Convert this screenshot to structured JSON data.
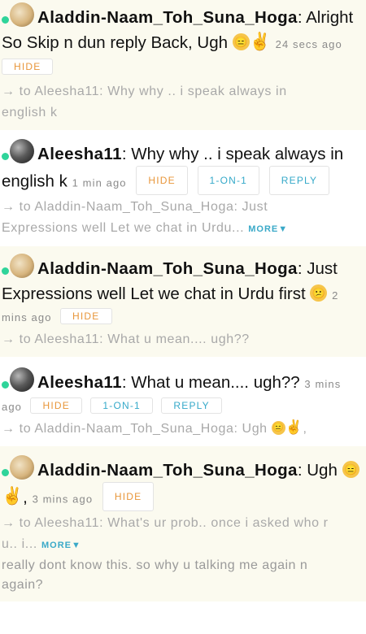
{
  "messages": [
    {
      "user": "Aladdin-Naam_Toh_Suna_Hoga",
      "text_line1": ": Alright",
      "text_line2": "So Skip n dun reply Back, Ugh",
      "time": "24 secs ago",
      "hide": "HIDE",
      "reply_to_line1": "→ to Aleesha11: Why why .. i speak always in",
      "reply_to_line2": "english k"
    },
    {
      "user": "Aleesha11",
      "text_line1": ": Why why .. i speak always in",
      "text_line2": "english k",
      "time": "1 min ago",
      "hide": "HIDE",
      "one_on_one": "1-ON-1",
      "reply": "REPLY",
      "reply_to_line1": "→ to Aladdin-Naam_Toh_Suna_Hoga: Just",
      "reply_to_line2": "Expressions well Let we chat in Urdu...",
      "more": "MORE▼"
    },
    {
      "user": "Aladdin-Naam_Toh_Suna_Hoga",
      "text_line1": ": Just",
      "text_line2": "Expressions well Let we chat in Urdu first",
      "time_a": "2",
      "time_b": "mins ago",
      "hide": "HIDE",
      "reply_to_line1": "→ to Aleesha11: What u mean.... ugh??"
    },
    {
      "user": "Aleesha11",
      "text_line1": ": What u mean.... ugh??",
      "time_a": "3 mins",
      "time_b": "ago",
      "hide": "HIDE",
      "one_on_one": "1-ON-1",
      "reply": "REPLY",
      "reply_to_line1": "→ to Aladdin-Naam_Toh_Suna_Hoga: Ugh",
      "reply_to_tail": ","
    },
    {
      "user": "Aladdin-Naam_Toh_Suna_Hoga",
      "text_line1": ": Ugh",
      "text_line2_suffix": ",",
      "time": "3 mins ago",
      "hide": "HIDE",
      "reply_to_line1": "→ to Aleesha11: What's ur prob.. once i asked who r",
      "reply_to_line2": "u.. i...",
      "more": "MORE▼",
      "tail_line1": "really dont know this. so why u talking me again n",
      "tail_line2": "again?"
    }
  ],
  "colors": {
    "online": "#2fd49a",
    "hide": "#e8963a",
    "action": "#35a9c9",
    "muted": "#a9a9a9"
  },
  "icons": {
    "online_dot": "online-status-icon",
    "emoji_unamused": "unamused-face-icon",
    "emoji_peace": "victory-hand-icon",
    "emoji_confused": "confused-face-icon"
  }
}
